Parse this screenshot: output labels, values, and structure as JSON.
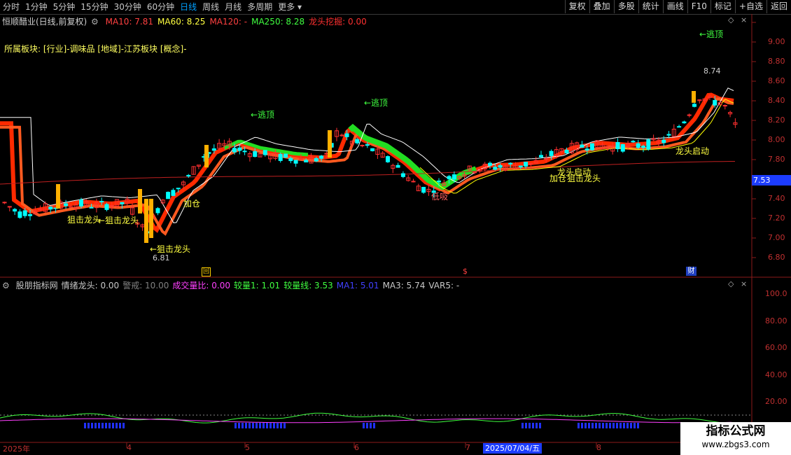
{
  "toolbar": {
    "periods": [
      "分时",
      "1分钟",
      "5分钟",
      "15分钟",
      "30分钟",
      "60分钟",
      "日线",
      "周线",
      "月线",
      "多周期",
      "更多"
    ],
    "active_period": "日线",
    "right_buttons": [
      "复权",
      "叠加",
      "多股",
      "统计",
      "画线",
      "F10",
      "标记",
      "+自选",
      "返回"
    ]
  },
  "main_panel": {
    "stock_title": "恒顺醋业(日线,前复权)",
    "ma_items": [
      {
        "label": "MA10: 7.81",
        "color": "#ff4040"
      },
      {
        "label": "MA60: 8.25",
        "color": "#ffff40"
      },
      {
        "label": "MA120: -",
        "color": "#ff4040"
      },
      {
        "label": "MA250: 8.28",
        "color": "#40ff40"
      },
      {
        "label": "龙头挖掘: 0.00",
        "color": "#ff3030"
      }
    ],
    "sector_line": "所属板块: [行业]-调味品 [地域]-江苏板块 [概念]-",
    "current_price_tag": "7.53",
    "price_axis": [
      "9.00",
      "8.80",
      "8.60",
      "8.40",
      "8.20",
      "8.00",
      "7.80",
      "7.40",
      "7.20",
      "7.00",
      "6.80"
    ],
    "signals": {
      "escape_top": "←逃顶",
      "snipe_dragon": "←狙击龙头",
      "add_position": "加仓",
      "bottom_buy": "低吸",
      "dragon_start": "龙头启动",
      "high_label": "8.74",
      "low_label": "6.81",
      "mid_snipe": "狙击龙头",
      "overlap_text1": "龙头启动",
      "overlap_text2": "加仓"
    },
    "markers": {
      "box_marker": "回",
      "s_marker": "$",
      "fin_marker": "财"
    }
  },
  "sub_panel": {
    "items": [
      {
        "label": "股朋指标网",
        "color": "#c8c8c8"
      },
      {
        "label": "情绪龙头: 0.00",
        "color": "#c8c8c8"
      },
      {
        "label": "警戒: 10.00",
        "color": "#808080"
      },
      {
        "label": "成交量比: 0.00",
        "color": "#ff40ff"
      },
      {
        "label": "较量1: 1.01",
        "color": "#40ff40"
      },
      {
        "label": "较量线: 3.53",
        "color": "#40ff40"
      },
      {
        "label": "MA1: 5.01",
        "color": "#4040ff"
      },
      {
        "label": "MA3: 5.74",
        "color": "#c8c8c8"
      },
      {
        "label": "VAR5: -",
        "color": "#c8c8c8"
      }
    ],
    "axis": [
      "100.0",
      "80.00",
      "60.00",
      "40.00",
      "20.00"
    ]
  },
  "date_axis": {
    "labels": [
      "2025年",
      "4",
      "5",
      "6",
      "7",
      "8"
    ],
    "cursor_date": "2025/07/04/五"
  },
  "watermark": {
    "title": "指标公式网",
    "url": "www.zbgs3.com"
  },
  "colors": {
    "up": "#ff3030",
    "down": "#00ffff",
    "ma_red": "#ff2a00",
    "ma_green": "#22dd22",
    "yellow": "#ffff00"
  }
}
